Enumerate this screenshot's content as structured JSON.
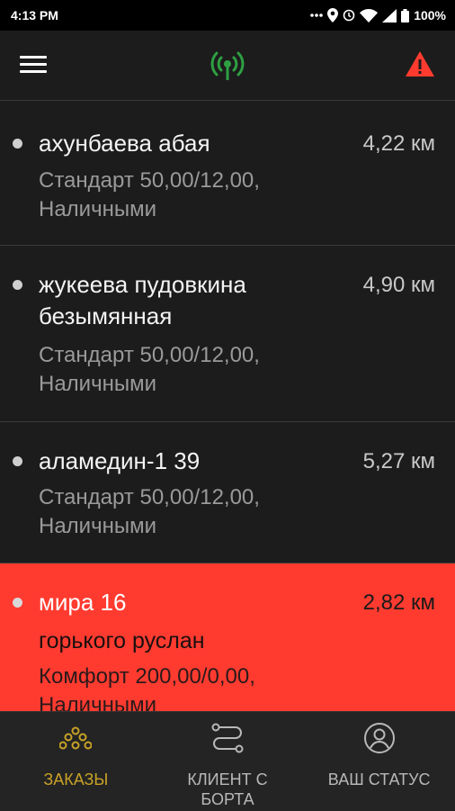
{
  "status_bar": {
    "time": "4:13 PM",
    "battery": "100%"
  },
  "app_bar": {
    "menu_icon": "hamburger-menu-icon",
    "signal_icon": "broadcast-signal-icon",
    "alert_icon": "warning-icon"
  },
  "orders": [
    {
      "address": "ахунбаева  абая",
      "distance": "4,22 км",
      "tariff": "Стандарт 50,00/12,00,",
      "payment": "Наличными"
    },
    {
      "address": "жукеева пудовкина безымянная",
      "distance": "4,90 км",
      "tariff": "Стандарт 50,00/12,00,",
      "payment": "Наличными"
    },
    {
      "address": "аламедин-1  39",
      "distance": "5,27 км",
      "tariff": "Стандарт 50,00/12,00,",
      "payment": "Наличными"
    },
    {
      "address": "мира 16",
      "distance": "2,82 км",
      "client": "горького руслан",
      "tariff": "Комфорт 200,00/0,00,",
      "payment": "Наличными"
    }
  ],
  "tabs": [
    {
      "label": "ЗАКАЗЫ",
      "icon": "orders-grid-icon",
      "active": true
    },
    {
      "label": "КЛИЕНТ С БОРТА",
      "icon": "route-icon",
      "active": false
    },
    {
      "label": "ВАШ СТАТУС",
      "icon": "user-circle-icon",
      "active": false
    }
  ],
  "colors": {
    "background": "#1c1c1c",
    "active_order": "#ff3b30",
    "active_tab": "#c9a227",
    "signal": "#2ea043",
    "alert": "#ff3b30"
  }
}
